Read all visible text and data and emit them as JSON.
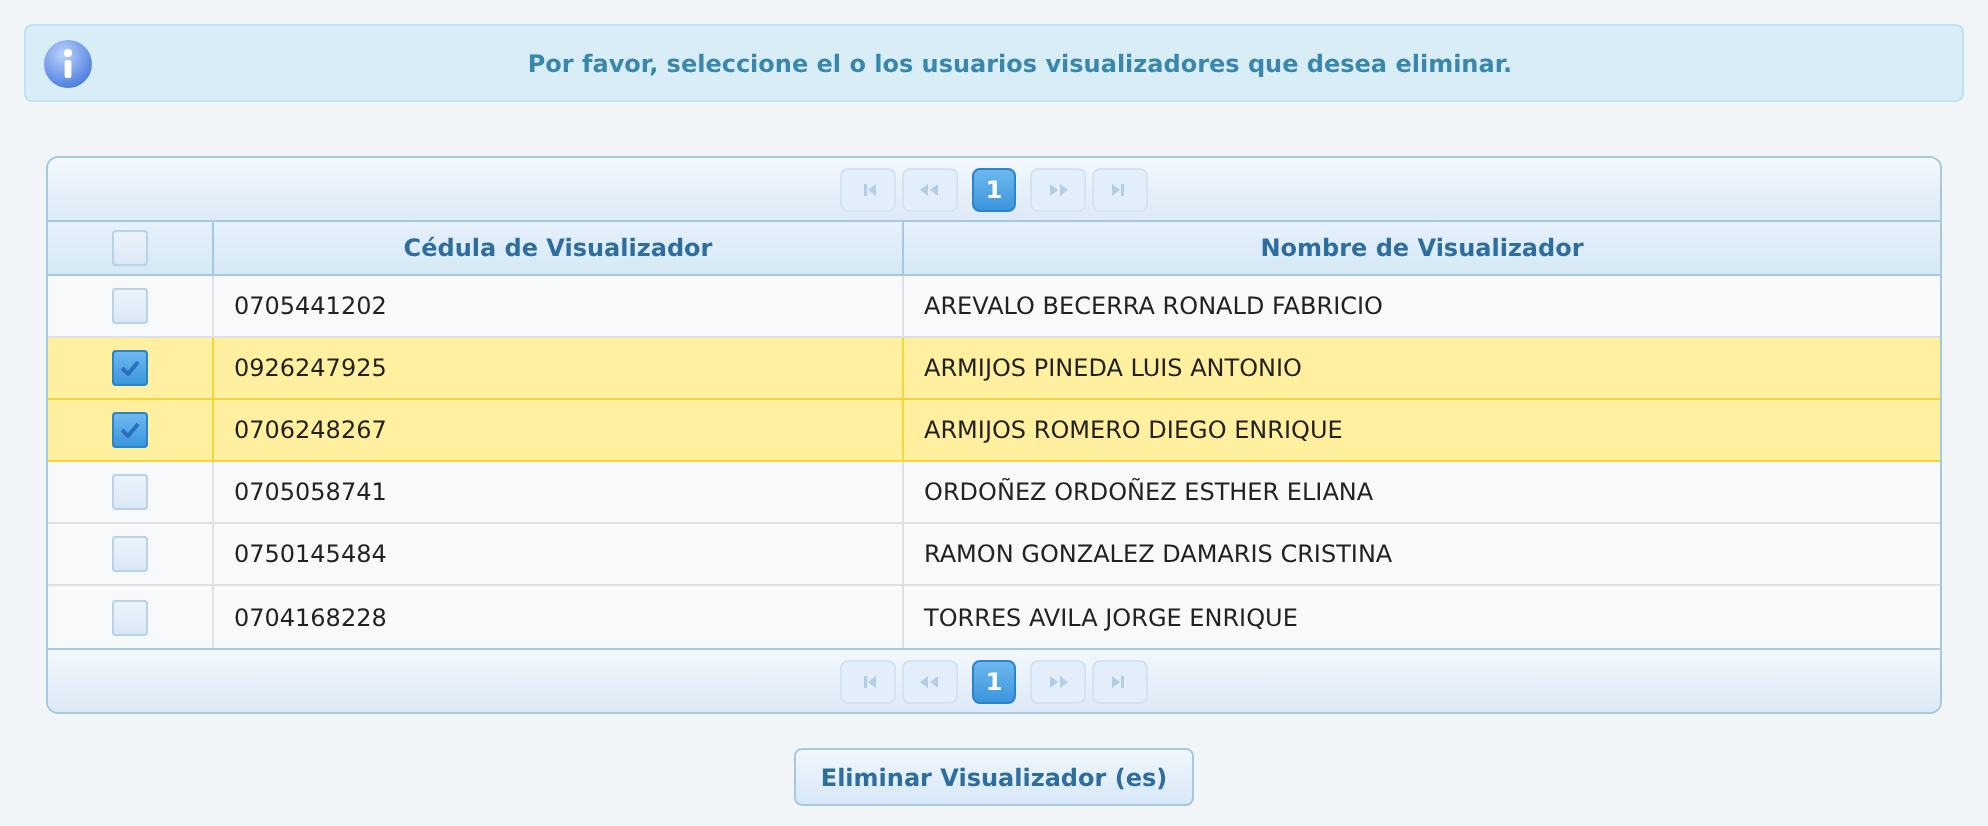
{
  "message": {
    "text": "Por favor, seleccione el o los usuarios visualizadores que desea eliminar."
  },
  "paginator_top": {
    "nav_disabled": true,
    "pages": [
      {
        "label": "1",
        "selected": true
      }
    ]
  },
  "table": {
    "select_all_checked": false,
    "columns": [
      "Cédula de Visualizador",
      "Nombre de Visualizador"
    ],
    "rows": [
      {
        "checked": false,
        "cells": [
          "0705441202",
          "AREVALO BECERRA RONALD FABRICIO"
        ]
      },
      {
        "checked": true,
        "cells": [
          "0926247925",
          "ARMIJOS PINEDA LUIS ANTONIO"
        ]
      },
      {
        "checked": true,
        "cells": [
          "0706248267",
          "ARMIJOS ROMERO DIEGO ENRIQUE"
        ]
      },
      {
        "checked": false,
        "cells": [
          "0705058741",
          "ORDOÑEZ ORDOÑEZ ESTHER ELIANA"
        ]
      },
      {
        "checked": false,
        "cells": [
          "0750145484",
          "RAMON GONZALEZ DAMARIS CRISTINA"
        ]
      },
      {
        "checked": false,
        "cells": [
          "0704168228",
          "TORRES AVILA JORGE ENRIQUE"
        ]
      }
    ]
  },
  "paginator_bottom": {
    "nav_disabled": true,
    "pages": [
      {
        "label": "1",
        "selected": true
      }
    ]
  },
  "button": {
    "label": "Eliminar Visualizador (es)"
  }
}
